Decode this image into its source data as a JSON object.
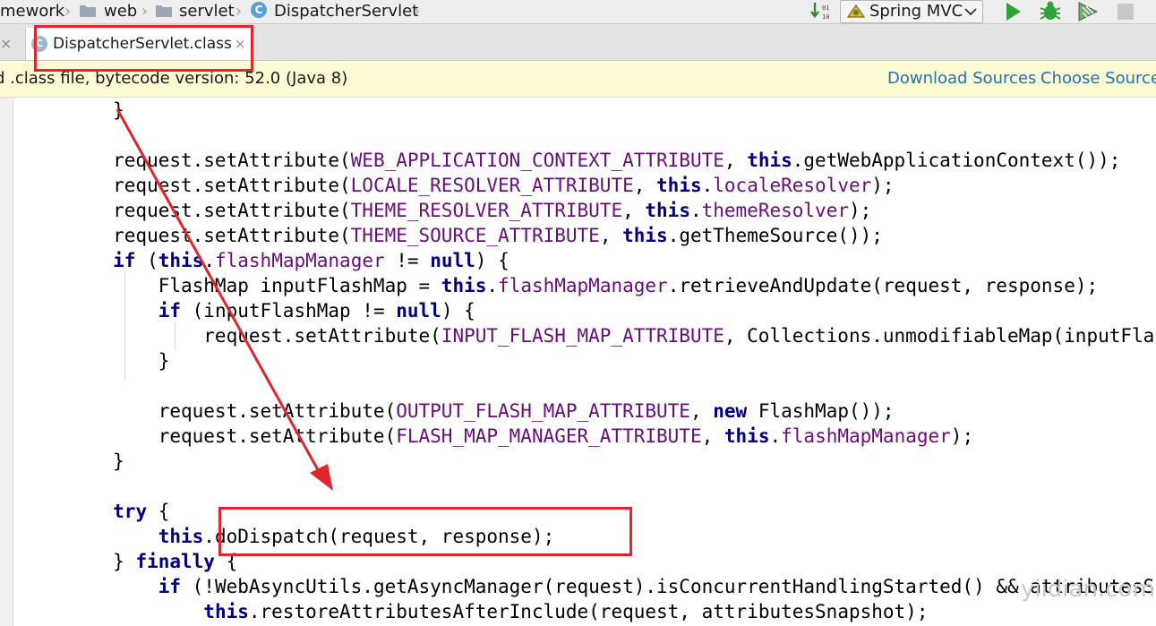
{
  "navbar": {
    "breadcrumbs": [
      "mework",
      "web",
      "servlet",
      "DispatcherServlet"
    ],
    "run_config": "Spring MVC",
    "icons": [
      "folder-icon",
      "class-icon",
      "sort-icon",
      "run-icon",
      "debug-icon",
      "coverage-icon",
      "stop-icon"
    ]
  },
  "tab": {
    "label": "DispatcherServlet.class",
    "close": "×",
    "prev_close": "×"
  },
  "notice": {
    "message": "d .class file, bytecode version: 52.0 (Java 8)",
    "download_sources": "Download Sources",
    "choose_sources": "Choose Sources"
  },
  "code": {
    "lines": [
      [
        {
          "t": "        }"
        }
      ],
      [
        {
          "t": ""
        }
      ],
      [
        {
          "t": "        request.setAttribute("
        },
        {
          "t": "WEB_APPLICATION_CONTEXT_ATTRIBUTE",
          "c": "fld"
        },
        {
          "t": ", "
        },
        {
          "t": "this",
          "c": "kw"
        },
        {
          "t": ".getWebApplicationContext());"
        }
      ],
      [
        {
          "t": "        request.setAttribute("
        },
        {
          "t": "LOCALE_RESOLVER_ATTRIBUTE",
          "c": "fld"
        },
        {
          "t": ", "
        },
        {
          "t": "this",
          "c": "kw"
        },
        {
          "t": "."
        },
        {
          "t": "localeResolver",
          "c": "fld"
        },
        {
          "t": ");"
        }
      ],
      [
        {
          "t": "        request.setAttribute("
        },
        {
          "t": "THEME_RESOLVER_ATTRIBUTE",
          "c": "fld"
        },
        {
          "t": ", "
        },
        {
          "t": "this",
          "c": "kw"
        },
        {
          "t": "."
        },
        {
          "t": "themeResolver",
          "c": "fld"
        },
        {
          "t": ");"
        }
      ],
      [
        {
          "t": "        request.setAttribute("
        },
        {
          "t": "THEME_SOURCE_ATTRIBUTE",
          "c": "fld"
        },
        {
          "t": ", "
        },
        {
          "t": "this",
          "c": "kw"
        },
        {
          "t": ".getThemeSource());"
        }
      ],
      [
        {
          "t": "        "
        },
        {
          "t": "if",
          "c": "kw"
        },
        {
          "t": " ("
        },
        {
          "t": "this",
          "c": "kw"
        },
        {
          "t": "."
        },
        {
          "t": "flashMapManager",
          "c": "fld"
        },
        {
          "t": " != "
        },
        {
          "t": "null",
          "c": "kw"
        },
        {
          "t": ") {"
        }
      ],
      [
        {
          "t": "            FlashMap inputFlashMap = "
        },
        {
          "t": "this",
          "c": "kw"
        },
        {
          "t": "."
        },
        {
          "t": "flashMapManager",
          "c": "fld"
        },
        {
          "t": ".retrieveAndUpdate(request, response);"
        }
      ],
      [
        {
          "t": "            "
        },
        {
          "t": "if",
          "c": "kw"
        },
        {
          "t": " (inputFlashMap != "
        },
        {
          "t": "null",
          "c": "kw"
        },
        {
          "t": ") {"
        }
      ],
      [
        {
          "t": "                request.setAttribute("
        },
        {
          "t": "INPUT_FLASH_MAP_ATTRIBUTE",
          "c": "fld"
        },
        {
          "t": ", Collections.unmodifiableMap(inputFlashMap));"
        }
      ],
      [
        {
          "t": "            }"
        }
      ],
      [
        {
          "t": ""
        }
      ],
      [
        {
          "t": "            request.setAttribute("
        },
        {
          "t": "OUTPUT_FLASH_MAP_ATTRIBUTE",
          "c": "fld"
        },
        {
          "t": ", "
        },
        {
          "t": "new",
          "c": "kw"
        },
        {
          "t": " FlashMap());"
        }
      ],
      [
        {
          "t": "            request.setAttribute("
        },
        {
          "t": "FLASH_MAP_MANAGER_ATTRIBUTE",
          "c": "fld"
        },
        {
          "t": ", "
        },
        {
          "t": "this",
          "c": "kw"
        },
        {
          "t": "."
        },
        {
          "t": "flashMapManager",
          "c": "fld"
        },
        {
          "t": ");"
        }
      ],
      [
        {
          "t": "        }"
        }
      ],
      [
        {
          "t": ""
        }
      ],
      [
        {
          "t": "        "
        },
        {
          "t": "try",
          "c": "kw"
        },
        {
          "t": " {"
        }
      ],
      [
        {
          "t": "            "
        },
        {
          "t": "this",
          "c": "kw"
        },
        {
          "t": ".doDispatch(request, response);"
        }
      ],
      [
        {
          "t": "        } "
        },
        {
          "t": "finally",
          "c": "kw"
        },
        {
          "t": " {"
        }
      ],
      [
        {
          "t": "            "
        },
        {
          "t": "if",
          "c": "kw"
        },
        {
          "t": " (!WebAsyncUtils.getAsyncManager(request).isConcurrentHandlingStarted() && attributesSnapshot != "
        },
        {
          "t": "null",
          "c": "kw"
        },
        {
          "t": ") {"
        }
      ],
      [
        {
          "t": "                "
        },
        {
          "t": "this",
          "c": "kw"
        },
        {
          "t": ".restoreAttributesAfterInclude(request, attributesSnapshot);"
        }
      ]
    ]
  },
  "watermark": "yiidian.com",
  "colors": {
    "keyword": "#000080",
    "field": "#660e7a",
    "annotation_red": "#e0262c",
    "link": "#2470b3",
    "notice_bg": "#fdfbd3"
  }
}
